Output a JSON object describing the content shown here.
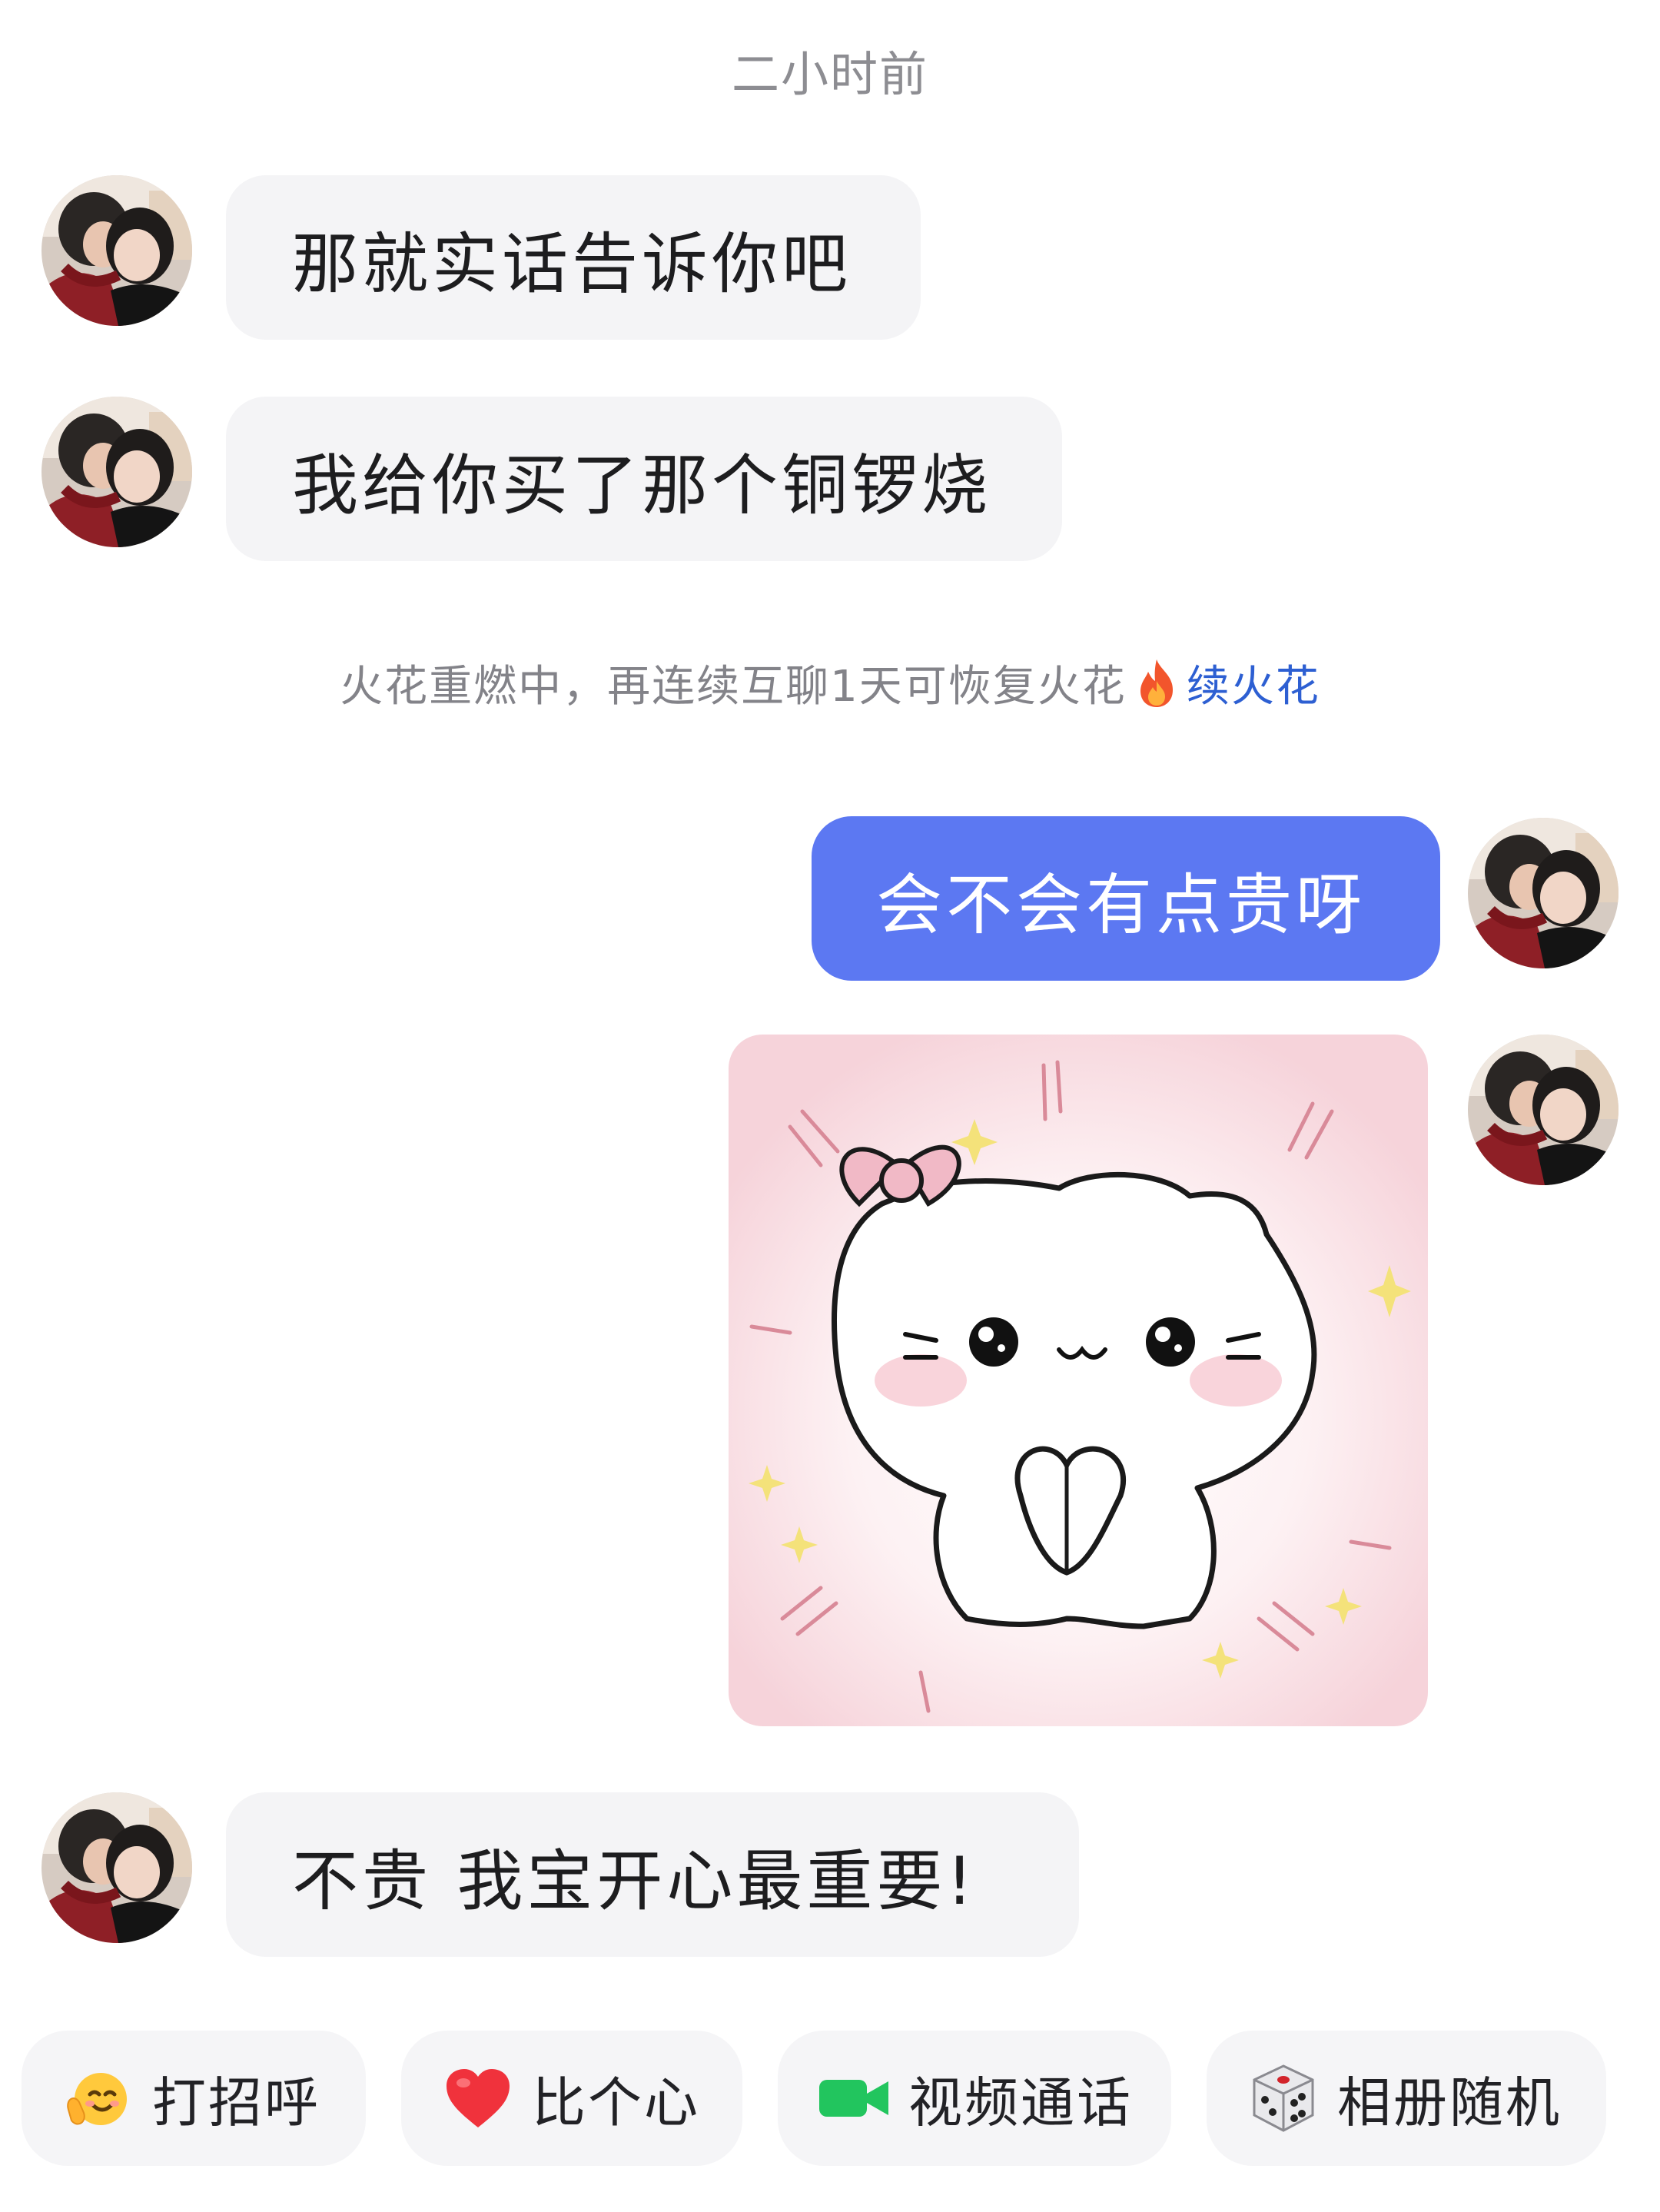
{
  "chat": {
    "timestamp": "二小时前",
    "messages": [
      {
        "text": "那就实话告诉你吧"
      },
      {
        "text": "我给你买了那个铜锣烧"
      },
      {
        "text": "会不会有点贵呀"
      },
      {
        "text": "不贵 我宝开心最重要!"
      }
    ],
    "notice": {
      "text": "火花重燃中，再连续互聊1天可恢复火花",
      "link": "续火花"
    }
  },
  "quick_actions": [
    {
      "label": "打招呼",
      "icon": "waving-face-icon"
    },
    {
      "label": "比个心",
      "icon": "heart-icon"
    },
    {
      "label": "视频通话",
      "icon": "video-camera-icon"
    },
    {
      "label": "相册随机",
      "icon": "dice-icon"
    }
  ],
  "colors": {
    "outgoing_bubble": "#5c78f2",
    "incoming_bubble": "#f4f4f6",
    "link": "#2d5fd2"
  }
}
